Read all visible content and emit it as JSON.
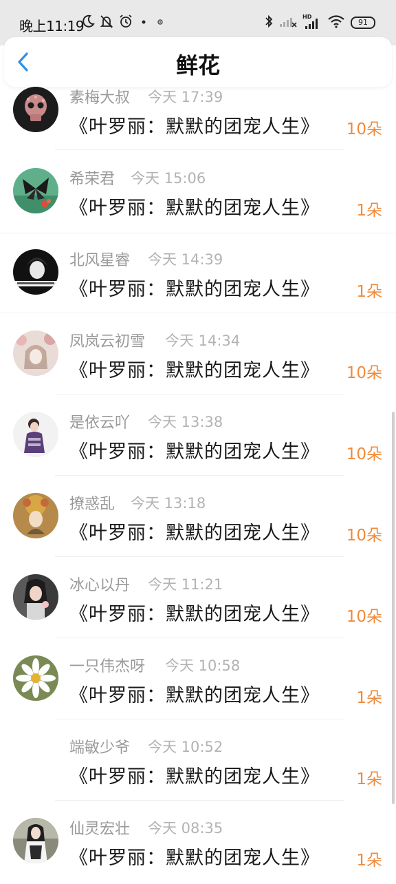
{
  "status_bar": {
    "time": "晚上11:19",
    "battery": "91",
    "network_label": "HD"
  },
  "header": {
    "title": "鲜花"
  },
  "records": [
    {
      "name": "素梅大叔",
      "time": "今天 17:39",
      "book": "《叶罗丽：默默的团宠人生》",
      "amount": "10朵"
    },
    {
      "name": "希荣君",
      "time": "今天 15:06",
      "book": "《叶罗丽：默默的团宠人生》",
      "amount": "1朵"
    },
    {
      "name": "北风星睿",
      "time": "今天 14:39",
      "book": "《叶罗丽：默默的团宠人生》",
      "amount": "1朵"
    },
    {
      "name": "凤岚云初雪",
      "time": "今天 14:34",
      "book": "《叶罗丽：默默的团宠人生》",
      "amount": "10朵"
    },
    {
      "name": "是依云吖",
      "time": "今天 13:38",
      "book": "《叶罗丽：默默的团宠人生》",
      "amount": "10朵"
    },
    {
      "name": "撩惑乱",
      "time": "今天 13:18",
      "book": "《叶罗丽：默默的团宠人生》",
      "amount": "10朵"
    },
    {
      "name": "冰心以丹",
      "time": "今天 11:21",
      "book": "《叶罗丽：默默的团宠人生》",
      "amount": "10朵"
    },
    {
      "name": "一只伟杰呀",
      "time": "今天 10:58",
      "book": "《叶罗丽：默默的团宠人生》",
      "amount": "1朵"
    },
    {
      "name": "端敏少爷",
      "time": "今天 10:52",
      "book": "《叶罗丽：默默的团宠人生》",
      "amount": "1朵"
    },
    {
      "name": "仙灵宏壮",
      "time": "今天 08:35",
      "book": "《叶罗丽：默默的团宠人生》",
      "amount": "1朵"
    }
  ],
  "colors": {
    "accent": "#f08a3a",
    "back_arrow": "#2f8fe8"
  }
}
